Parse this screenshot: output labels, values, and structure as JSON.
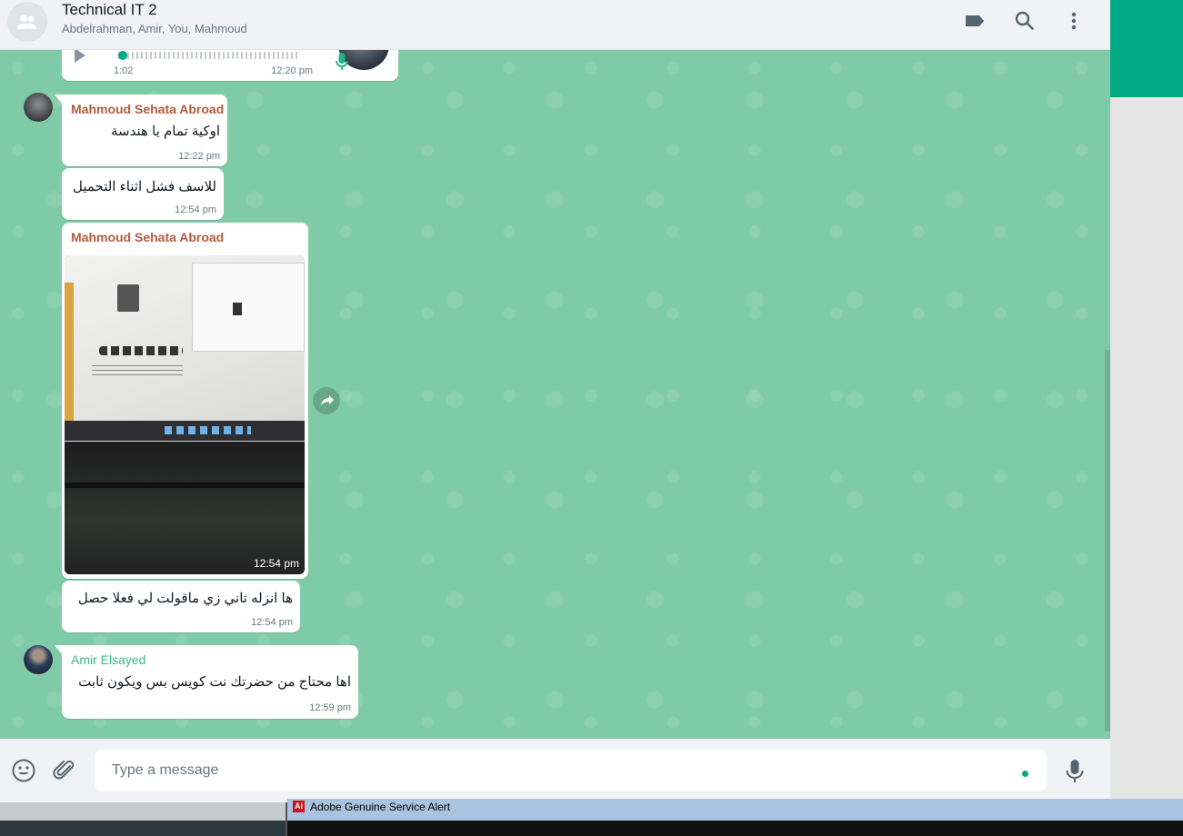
{
  "header": {
    "title": "Technical IT 2",
    "subtitle": "Abdelrahman, Amir, You, Mahmoud",
    "icons": [
      "label-icon",
      "search-icon",
      "menu-icon"
    ]
  },
  "messages": {
    "voice": {
      "duration": "1:02",
      "time": "12:20 pm"
    },
    "m1": {
      "sender": "Mahmoud Sehata Abroad",
      "text": "اوكية تمام يا هندسة",
      "time": "12:22 pm"
    },
    "m2": {
      "text": "للاسف فشل اثناء التحميل",
      "time": "12:54 pm"
    },
    "m3": {
      "sender": "Mahmoud Sehata Abroad",
      "time": "12:54 pm"
    },
    "m4": {
      "text": "ها انزله تاني زي ماقولت لي فعلا حصل",
      "time": "12:54 pm"
    },
    "m5": {
      "sender": "Amir Elsayed",
      "text": "اها محتاج من حضرتك نت كويس بس ويكون ثابت",
      "time": "12:59 pm"
    }
  },
  "colors": {
    "sender_mahmoud": "#b35b3c",
    "sender_amir": "#35b98b",
    "chat_bg": "#80cba7",
    "accent": "#00a884"
  },
  "composer": {
    "placeholder": "Type a message"
  },
  "taskbar": {
    "window_title": "Adobe Genuine Service Alert",
    "icon_text": "Ai"
  }
}
